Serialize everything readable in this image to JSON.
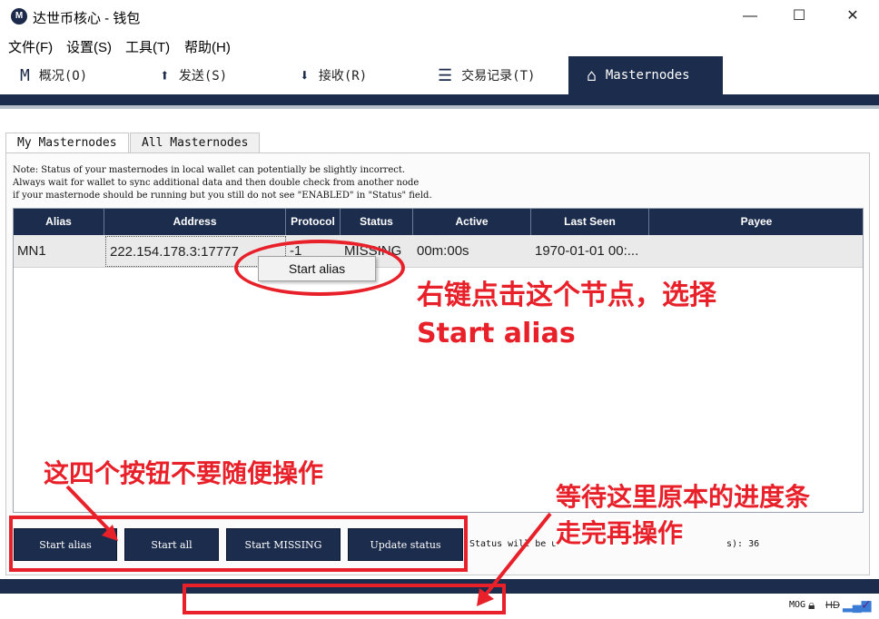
{
  "window": {
    "title": "达世币核心 - 钱包",
    "icon": "M",
    "controls": [
      "—",
      "☐",
      "✕"
    ]
  },
  "menu": [
    "文件(F)",
    "设置(S)",
    "工具(T)",
    "帮助(H)"
  ],
  "toolbar": [
    {
      "label": "概况(O)",
      "icon": "overview-icon",
      "glyph": "M"
    },
    {
      "label": "发送(S)",
      "icon": "send-arrow-up-icon",
      "glyph": "⬆"
    },
    {
      "label": "接收(R)",
      "icon": "receive-arrow-down-icon",
      "glyph": "⬇"
    },
    {
      "label": "交易记录(T)",
      "icon": "transactions-list-icon",
      "glyph": "☰"
    },
    {
      "label": "Masternodes",
      "icon": "masternodes-house-icon",
      "glyph": "⌂",
      "active": true
    }
  ],
  "tabs": {
    "my": "My Masternodes",
    "all": "All Masternodes"
  },
  "note": [
    "Note: Status of your masternodes in local wallet can potentially be slightly incorrect.",
    "Always wait for wallet to sync additional data and then double check from another node",
    "if your masternode should be running but you still do not see \"ENABLED\" in \"Status\" field."
  ],
  "table": {
    "headers": [
      "Alias",
      "Address",
      "Protocol",
      "Status",
      "Active",
      "Last Seen",
      "Payee"
    ],
    "rows": [
      {
        "alias": "MN1",
        "address": "222.154.178.3:17777",
        "protocol": "-1",
        "status": "MISSING",
        "active": "00m:00s",
        "last_seen": "1970-01-01 00:...",
        "payee": ""
      }
    ]
  },
  "context_menu": {
    "item": "Start alias"
  },
  "buttons": {
    "start_alias": "Start alias",
    "start_all": "Start all",
    "start_missing": "Start MISSING",
    "update_status": "Update status"
  },
  "status_line": "Status will be u",
  "status_count": "s): 36",
  "statusbar": {
    "unit": "MOG"
  },
  "annotations": {
    "right_click": "右键点击这个节点，选择\nStart alias",
    "four_buttons": "这四个按钮不要随便操作",
    "wait_progress": "等待这里原本的进度条\n走完再操作"
  },
  "colors": {
    "navy": "#1c2c4c",
    "annotation_red": "#e8202a"
  }
}
